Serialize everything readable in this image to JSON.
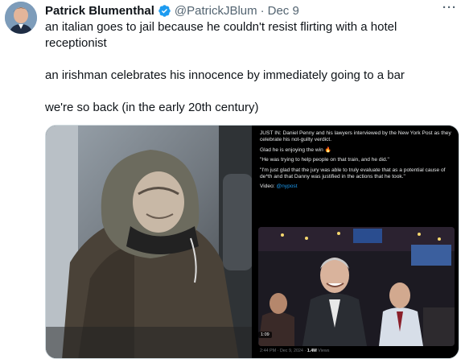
{
  "author": {
    "display_name": "Patrick Blumenthal",
    "handle": "@PatrickJBlum",
    "separator": "·",
    "date": "Dec 9"
  },
  "more_menu_icon": "more-dots-icon",
  "tweet": {
    "line1": "an italian goes to jail because he couldn't resist flirting with a hotel receptionist",
    "line2": "an irishman celebrates his innocence by immediately going to a bar",
    "line3": "we're so back (in the early 20th century)"
  },
  "embedded_post": {
    "headline": "JUST IN: Daniel Penny and his lawyers interviewed by the New York Post as they celebrate his not-guilty verdict.",
    "line_glad": "Glad he is enjoying the win 🔥",
    "quote1": "\"He was trying to help people on that train, and he did.\"",
    "quote2": "\"I'm just glad that the jury was able to truly evaluate that as a potential cause of de*th and that Danny was justified in the actions that he took.\"",
    "video_label": "Video: ",
    "video_link": "@nypost",
    "video_duration": "1:09",
    "timestamp": "2:44 PM · Dec 9, 2024 · ",
    "views": "1.4M",
    "views_label": " Views"
  },
  "colors": {
    "verified": "#1d9bf0",
    "link": "#1d9bf0",
    "text_secondary": "#536471"
  }
}
